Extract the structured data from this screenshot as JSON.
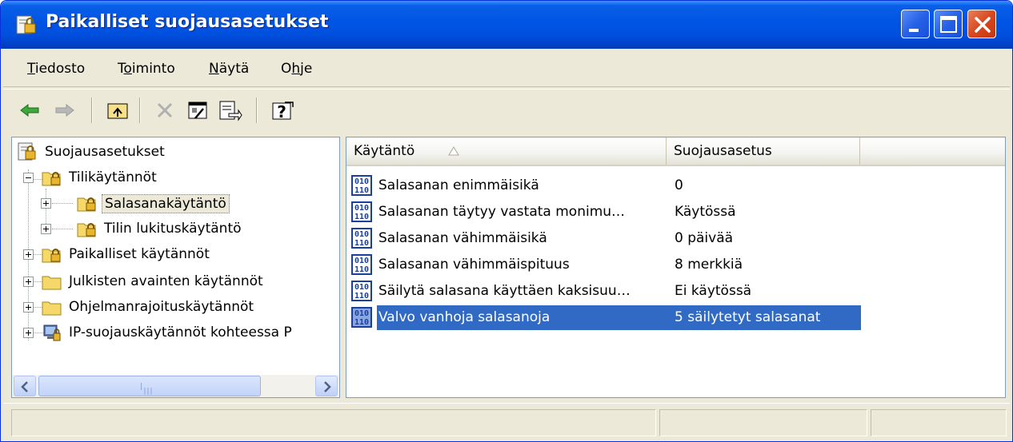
{
  "window": {
    "title": "Paikalliset suojausasetukset",
    "title_icon": "security-settings-icon",
    "accent_color": "#0054e3",
    "close_color": "#d9481f"
  },
  "menu": {
    "items": [
      {
        "label": "Tiedosto",
        "accel": "T"
      },
      {
        "label": "Toiminto",
        "accel": "o"
      },
      {
        "label": "Näytä",
        "accel": "N"
      },
      {
        "label": "Ohje",
        "accel": "h"
      }
    ]
  },
  "toolbar": {
    "buttons": [
      "back-arrow-icon",
      "forward-arrow-icon",
      "up-folder-icon",
      "delete-icon",
      "properties-icon",
      "export-list-icon",
      "help-icon"
    ]
  },
  "tree": {
    "items": [
      {
        "label": "Suojausasetukset",
        "icon": "security-settings-icon"
      },
      {
        "label": "Tilikäytännöt",
        "icon": "locked-folder-icon"
      },
      {
        "label": "Salasanakäytäntö",
        "icon": "locked-folder-icon"
      },
      {
        "label": "Tilin lukituskäytäntö",
        "icon": "locked-folder-icon"
      },
      {
        "label": "Paikalliset käytännöt",
        "icon": "locked-folder-icon"
      },
      {
        "label": "Julkisten avainten käytännöt",
        "icon": "folder-icon"
      },
      {
        "label": "Ohjelmanrajoituskäytännöt",
        "icon": "folder-icon"
      },
      {
        "label": "IP-suojauskäytännöt kohteessa P",
        "icon": "ip-security-icon"
      }
    ]
  },
  "list": {
    "columns": [
      "Käytäntö",
      "Suojausasetus"
    ],
    "rows": [
      {
        "policy": "Salasanan enimmäisikä",
        "setting": "0",
        "icon": "policy-binary-icon"
      },
      {
        "policy": "Salasanan täytyy vastata monimu…",
        "setting": "Käytössä",
        "icon": "policy-binary-icon"
      },
      {
        "policy": "Salasanan vähimmäisikä",
        "setting": "0 päivää",
        "icon": "policy-binary-icon"
      },
      {
        "policy": "Salasanan vähimmäispituus",
        "setting": "8 merkkiä",
        "icon": "policy-binary-icon"
      },
      {
        "policy": "Säilytä salasana käyttäen kaksisuu…",
        "setting": "Ei käytössä",
        "icon": "policy-binary-icon"
      },
      {
        "policy": "Valvo vanhoja salasanoja",
        "setting": "5 säilytetyt salasanat",
        "icon": "policy-binary-icon"
      }
    ],
    "selection_color": "#316ac5"
  }
}
